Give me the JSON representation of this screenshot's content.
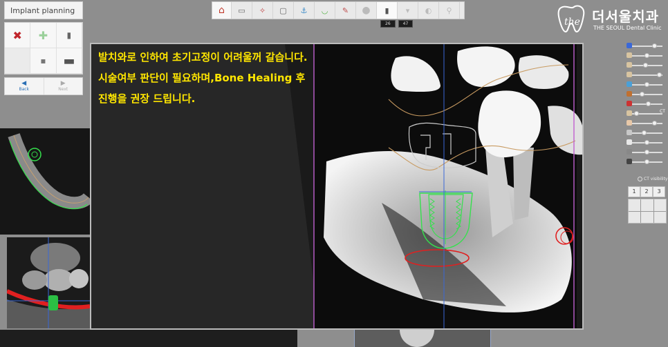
{
  "panel": {
    "title": "Implant planning",
    "back_label": "Back",
    "next_label": "Next"
  },
  "toolbar": {
    "tools": [
      "home-icon",
      "panorama-icon",
      "nerve-icon",
      "cross-section-icon",
      "implant-library-icon",
      "arch-icon",
      "bone-icon",
      "crown-icon",
      "implant-icon",
      "abutment-icon",
      "sleeve-icon",
      "guide-icon"
    ]
  },
  "tooth_labels": [
    "26",
    "47"
  ],
  "logo": {
    "korean": "더서울치과",
    "english": "THE SEOUL Dental Clinic"
  },
  "right_panel": {
    "ct_visibility_label": "CT visibility",
    "ct_label": "CT",
    "view_tabs": [
      "1",
      "2",
      "3"
    ],
    "sliders": [
      0.75,
      0.5,
      0.45,
      0.9,
      0.5,
      0.35,
      0.55,
      0.15,
      0.75,
      0.4,
      0.5,
      0.5,
      0.5
    ],
    "slider_icons": [
      "blue",
      "tan",
      "tan",
      "tan",
      "#4aa0d8",
      "#c07030",
      "#cc3333",
      "tan",
      "#e8c8a8",
      "#c8c8c8",
      "#e8e8e8",
      "#888",
      "#444"
    ]
  },
  "message": {
    "line1": "발치와로 인하여 초기고정이 어려울꺼 갈습니다.",
    "line2": "시술여부 판단이 필요하며,Bone Healing 후",
    "line3": "진행을 권장 드립니다."
  },
  "colors": {
    "message": "#ffe600",
    "implant_outline": "#35e04d",
    "warning_outline": "#e02020",
    "guide_line": "#c060d0",
    "axis_line": "#3a68d8",
    "nerve_line": "#c89a60"
  }
}
